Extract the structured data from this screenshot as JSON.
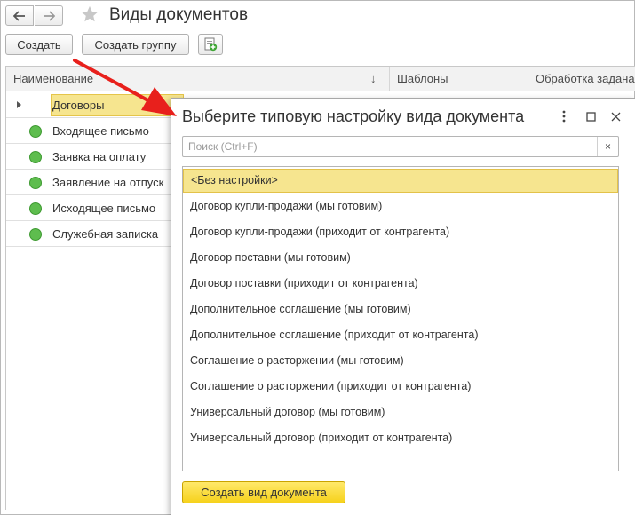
{
  "window": {
    "title": "Виды документов"
  },
  "toolbar": {
    "create_label": "Создать",
    "create_group_label": "Создать группу"
  },
  "table": {
    "columns": [
      "Наименование",
      "Шаблоны",
      "Обработка задана"
    ],
    "sort_indicator": "↓",
    "rows": [
      {
        "label": "Договоры",
        "type": "group"
      },
      {
        "label": "Входящее письмо",
        "type": "item"
      },
      {
        "label": "Заявка на оплату",
        "type": "item"
      },
      {
        "label": "Заявление на отпуск",
        "type": "item"
      },
      {
        "label": "Исходящее письмо",
        "type": "item"
      },
      {
        "label": "Служебная записка",
        "type": "item"
      }
    ]
  },
  "dialog": {
    "title": "Выберите типовую настройку вида документа",
    "search_placeholder": "Поиск (Ctrl+F)",
    "clear_label": "×",
    "items": [
      "<Без настройки>",
      "Договор купли-продажи (мы готовим)",
      "Договор купли-продажи (приходит от контрагента)",
      "Договор поставки (мы готовим)",
      "Договор поставки (приходит от контрагента)",
      "Дополнительное соглашение (мы готовим)",
      "Дополнительное соглашение (приходит от контрагента)",
      "Соглашение о расторжении (мы готовим)",
      "Соглашение о расторжении (приходит от контрагента)",
      "Универсальный договор (мы готовим)",
      "Универсальный договор (приходит от контрагента)"
    ],
    "selected_index": 0,
    "submit_label": "Создать вид документа"
  },
  "colors": {
    "accent_yellow": "#f6d21c",
    "selection": "#f6e58f",
    "status_green": "#5ebd4e",
    "arrow_red": "#e8201c"
  },
  "icons": [
    "arrow-left-icon",
    "arrow-right-icon",
    "star-icon",
    "excel-export-icon",
    "more-vertical-icon",
    "maximize-icon",
    "close-icon"
  ]
}
